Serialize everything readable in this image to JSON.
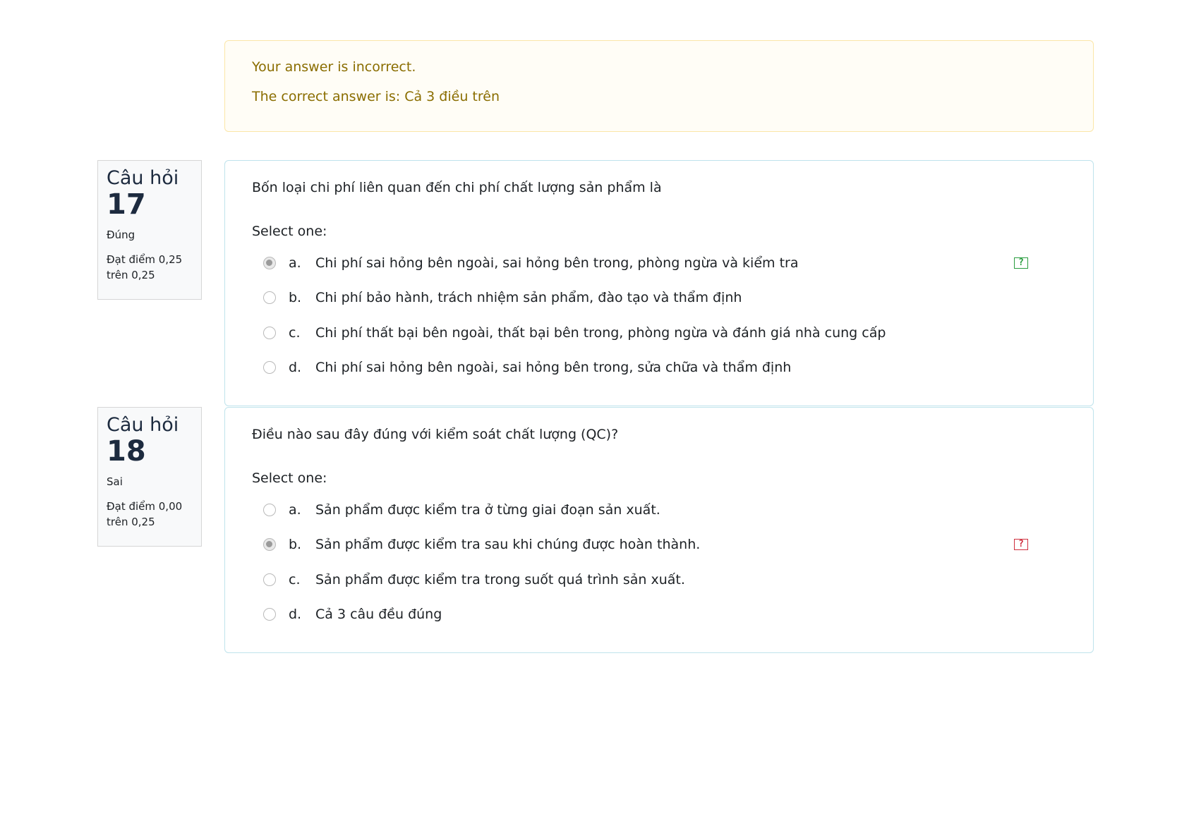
{
  "feedback": {
    "incorrect_msg": "Your answer is incorrect.",
    "correct_answer": "The correct answer is: Cả 3 điều trên"
  },
  "questions": [
    {
      "label": "Câu hỏi",
      "number": "17",
      "state": "Đúng",
      "grade_line1": "Đạt điểm 0,25",
      "grade_line2": "trên 0,25",
      "text": "Bốn loại chi phí liên quan đến chi phí chất lượng sản phẩm là",
      "prompt": "Select one:",
      "answers": [
        {
          "letter": "a.",
          "text": "Chi phí sai hỏng bên ngoài, sai hỏng bên trong, phòng ngừa và kiểm tra",
          "selected": true,
          "mark": "correct-icon"
        },
        {
          "letter": "b.",
          "text": "Chi phí bảo hành, trách nhiệm sản phẩm, đào tạo và thẩm định",
          "selected": false
        },
        {
          "letter": "c.",
          "text": "Chi phí thất bại bên ngoài, thất bại bên trong, phòng ngừa và đánh giá nhà cung cấp",
          "selected": false
        },
        {
          "letter": "d.",
          "text": "Chi phí sai hỏng bên ngoài, sai hỏng bên trong, sửa chữa và thẩm định",
          "selected": false
        }
      ]
    },
    {
      "label": "Câu hỏi",
      "number": "18",
      "state": "Sai",
      "grade_line1": "Đạt điểm 0,00",
      "grade_line2": "trên 0,25",
      "text": "Điều nào sau đây đúng với kiểm soát chất lượng (QC)?",
      "prompt": "Select one:",
      "answers": [
        {
          "letter": "a.",
          "text": "Sản phẩm được kiểm tra ở từng giai đoạn sản xuất.",
          "selected": false
        },
        {
          "letter": "b.",
          "text": "Sản phẩm được kiểm tra sau khi chúng được hoàn thành.",
          "selected": true,
          "mark": "incorrect-icon"
        },
        {
          "letter": "c.",
          "text": "Sản phẩm được kiểm tra trong suốt quá trình sản xuất.",
          "selected": false
        },
        {
          "letter": "d.",
          "text": "Cả 3 câu đều đúng",
          "selected": false
        }
      ]
    }
  ],
  "icons": {
    "mark_glyph": "?",
    "correct_color": "#2a9d3f",
    "incorrect_color": "#d0303f"
  }
}
